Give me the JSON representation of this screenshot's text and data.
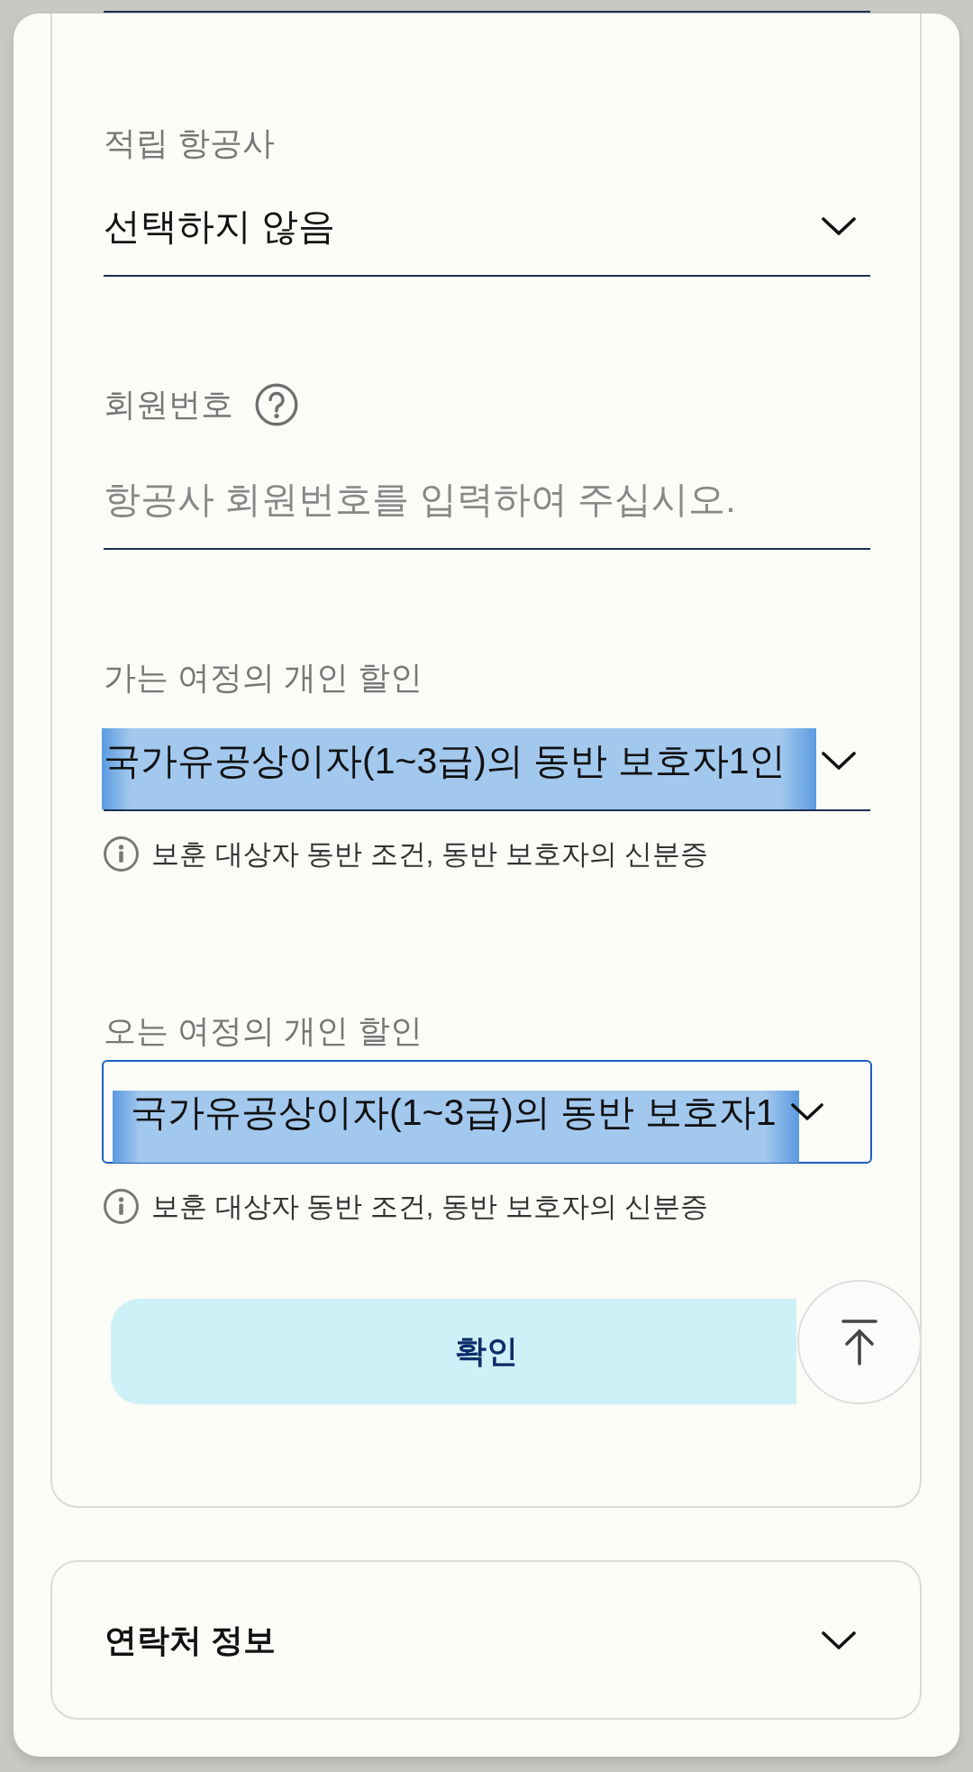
{
  "fields": [
    {
      "kind": "select",
      "label": "적립 항공사",
      "value": "선택하지 않음",
      "focused": false,
      "highlighted": false
    },
    {
      "kind": "input",
      "label": "회원번호",
      "help_icon": true,
      "placeholder": "항공사 회원번호를 입력하여 주십시오.",
      "focused": false,
      "highlighted": false
    },
    {
      "kind": "select",
      "label": "가는 여정의 개인 할인",
      "value": "국가유공상이자(1~3급)의 동반 보호자1인",
      "focused": false,
      "highlighted": true,
      "note": "보훈 대상자 동반 조건, 동반 보호자의 신분증"
    },
    {
      "kind": "select",
      "label": "오는 여정의 개인 할인",
      "value": "국가유공상이자(1~3급)의 동반 보호자1",
      "focused": true,
      "highlighted": true,
      "note": "보훈 대상자 동반 조건, 동반 보호자의 신분증"
    }
  ],
  "confirm_button": {
    "label": "확인"
  },
  "sections": [
    {
      "title": "연락처 정보",
      "expanded": false
    }
  ]
}
